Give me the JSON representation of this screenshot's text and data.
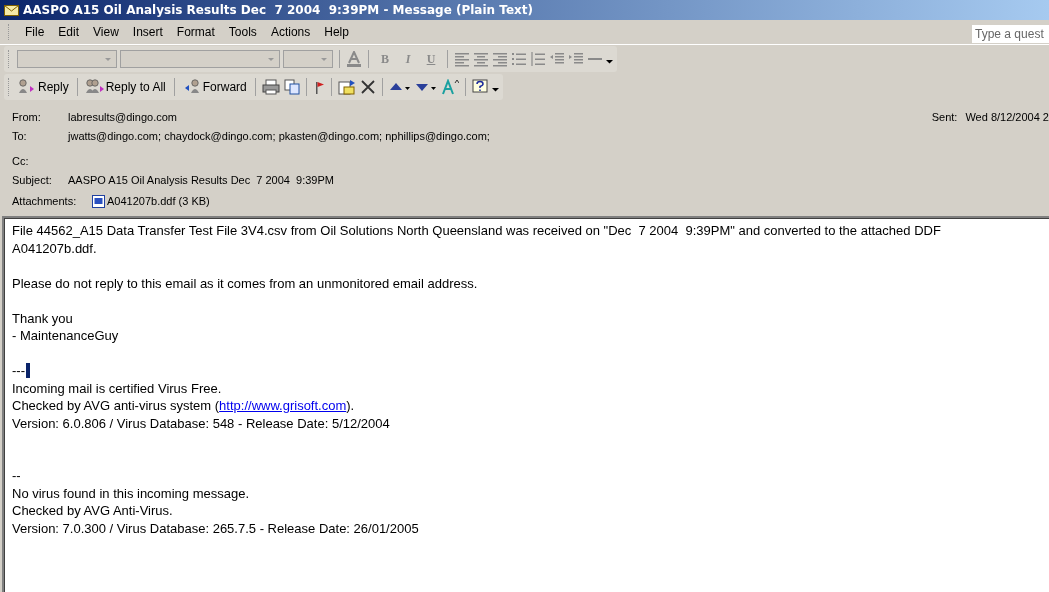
{
  "window": {
    "title": "AASPO A15 Oil Analysis Results Dec  7 2004  9:39PM - Message (Plain Text)"
  },
  "menu": [
    "File",
    "Edit",
    "View",
    "Insert",
    "Format",
    "Tools",
    "Actions",
    "Help"
  ],
  "help_box": {
    "placeholder": "Type a quest"
  },
  "format_toolbar": {
    "disabled": true,
    "buttons": [
      {
        "label": "B",
        "kind": "bold"
      },
      {
        "label": "I",
        "kind": "italic"
      },
      {
        "label": "U",
        "kind": "underline"
      }
    ]
  },
  "toolbar": {
    "buttons": [
      {
        "kind": "reply",
        "label": "Reply"
      },
      {
        "kind": "reply_all",
        "label": "Reply to All"
      },
      {
        "kind": "forward",
        "label": "Forward"
      }
    ]
  },
  "header": {
    "from": {
      "label": "From:",
      "value": "labresults@dingo.com"
    },
    "sent": {
      "label": "Sent:",
      "value": "Wed 8/12/2004 2"
    },
    "to": {
      "label": "To:",
      "value": "jwatts@dingo.com; chaydock@dingo.com; pkasten@dingo.com; nphillips@dingo.com;"
    },
    "cc": {
      "label": "Cc:"
    },
    "subject": {
      "label": "Subject:",
      "value": "AASPO A15 Oil Analysis Results Dec  7 2004  9:39PM"
    },
    "attachments": {
      "label": "Attachments:",
      "file": "A041207b.ddf (3 KB)"
    }
  },
  "body": {
    "paragraphs": [
      {
        "kind": "plain",
        "lines": [
          {
            "text": "File 44562_A15 Data Transfer Test File 3V4.csv from Oil Solutions North Queensland was received on \"Dec  7 2004  9:39PM\" and converted to the attached DDF"
          },
          {
            "text": "A041207b.ddf."
          }
        ]
      },
      {
        "kind": "spaced",
        "lines": [
          {
            "text": "Please do not reply to this email as it comes from an unmonitored email address."
          }
        ]
      },
      {
        "kind": "spaced",
        "lines": [
          {
            "text": "Thank you"
          },
          {
            "text": "- MaintenanceGuy"
          }
        ]
      },
      {
        "kind": "spaced",
        "lines": [
          {
            "text": "---",
            "cursor": true
          },
          {
            "text": "Incoming mail is certified Virus Free."
          },
          {
            "text": "Checked by AVG anti-virus system (",
            "link": "http://www.grisoft.com",
            "after": ")."
          },
          {
            "text": "Version: 6.0.806 / Virus Database: 548 - Release Date: 5/12/2004"
          }
        ]
      },
      {
        "kind": "double_spaced",
        "lines": [
          {
            "text": "--"
          },
          {
            "text": "No virus found in this incoming message."
          },
          {
            "text": "Checked by AVG Anti-Virus."
          },
          {
            "text": "Version: 7.0.300 / Virus Database: 265.7.5 - Release Date: 26/01/2005"
          }
        ]
      }
    ]
  }
}
